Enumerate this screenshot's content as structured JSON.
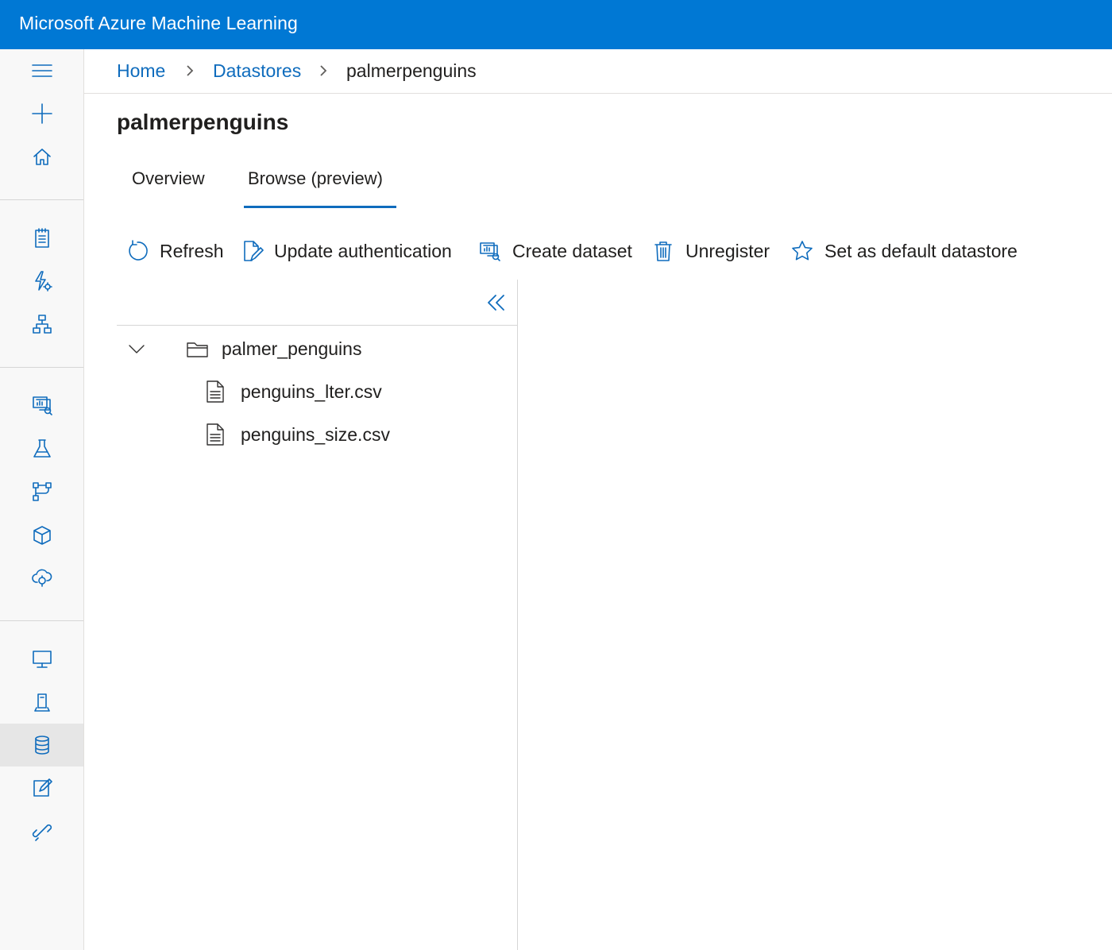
{
  "app": {
    "title": "Microsoft Azure Machine Learning"
  },
  "nav": {
    "items": [
      {
        "name": "menu-icon"
      },
      {
        "name": "new-icon"
      },
      {
        "name": "home-icon"
      },
      {
        "name": "notebooks-icon"
      },
      {
        "name": "automated-ml-icon"
      },
      {
        "name": "designer-icon"
      },
      {
        "name": "datasets-icon"
      },
      {
        "name": "experiments-icon"
      },
      {
        "name": "pipelines-icon"
      },
      {
        "name": "models-icon"
      },
      {
        "name": "endpoints-icon"
      },
      {
        "name": "compute-icon"
      },
      {
        "name": "environments-icon"
      },
      {
        "name": "datastores-icon",
        "selected": true
      },
      {
        "name": "data-labeling-icon"
      },
      {
        "name": "linked-services-icon"
      }
    ]
  },
  "breadcrumb": {
    "home": "Home",
    "datastores": "Datastores",
    "current": "palmerpenguins"
  },
  "page": {
    "title": "palmerpenguins"
  },
  "tabs": [
    {
      "label": "Overview",
      "active": false
    },
    {
      "label": "Browse (preview)",
      "active": true
    }
  ],
  "toolbar": {
    "refresh": "Refresh",
    "update_auth": "Update authentication",
    "create_dataset": "Create dataset",
    "unregister": "Unregister",
    "set_default": "Set as default datastore"
  },
  "tree": {
    "folder": {
      "name": "palmer_penguins",
      "expanded": true
    },
    "files": [
      {
        "name": "penguins_lter.csv"
      },
      {
        "name": "penguins_size.csv"
      }
    ]
  },
  "colors": {
    "header_blue": "#0078d4",
    "accent": "#0f6cbd",
    "nav_bg": "#f8f8f8",
    "nav_selected": "#e6e6e6"
  }
}
